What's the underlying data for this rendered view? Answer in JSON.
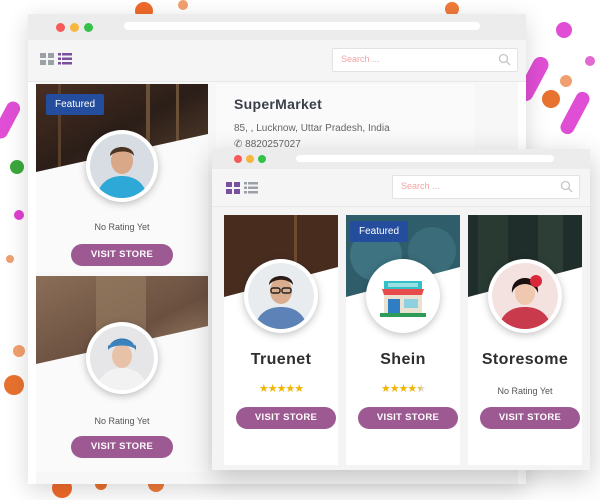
{
  "colors": {
    "accent": "#9d5a92",
    "featured": "#244e9d",
    "star": "#f2b400",
    "search_placeholder": "#f3a3a3"
  },
  "back_window": {
    "search_placeholder": "Search ...",
    "view_icons": [
      "grid-view-icon",
      "list-view-icon"
    ],
    "stores": [
      {
        "featured_label": "Featured",
        "rating_text": "No Rating Yet",
        "button_label": "VISIT STORE"
      },
      {
        "rating_text": "No Rating Yet",
        "button_label": "VISIT STORE"
      }
    ],
    "detail": {
      "name": "SuperMarket",
      "address": "85, , Lucknow, Uttar Pradesh, India",
      "phone": "8820257027"
    }
  },
  "front_window": {
    "search_placeholder": "Search ...",
    "view_icons": [
      "grid-view-icon",
      "list-view-icon"
    ],
    "stores": [
      {
        "name": "Truenet",
        "rating": 5,
        "stars": "★★★★★",
        "button_label": "VISIT STORE"
      },
      {
        "name": "Shein",
        "featured_label": "Featured",
        "rating": 4.5,
        "stars": "★★★★★",
        "button_label": "VISIT STORE"
      },
      {
        "name": "Storesome",
        "rating_text": "No Rating Yet",
        "button_label": "VISIT STORE"
      }
    ]
  }
}
